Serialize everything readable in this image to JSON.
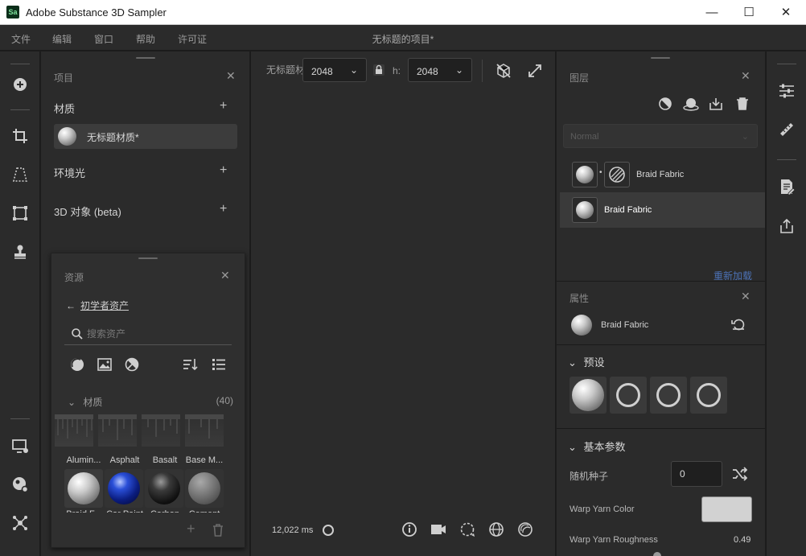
{
  "window": {
    "app_badge": "Sa",
    "title": "Adobe Substance 3D Sampler",
    "minimize": "—",
    "maximize": "☐",
    "close": "✕"
  },
  "menu": {
    "items": [
      "文件",
      "编辑",
      "窗口",
      "帮助",
      "许可证"
    ],
    "document_title": "无标题的项目*"
  },
  "project_panel": {
    "header": "项目",
    "sections": {
      "materials": "材质",
      "environment": "环境光",
      "objects_3d": "3D 对象 (beta)"
    },
    "material_item": "无标题材质*"
  },
  "assets_panel": {
    "header": "资源",
    "back_link": "初学者资产",
    "search_placeholder": "搜索资产",
    "section": "材质",
    "count": "(40)",
    "labels_row1": [
      "Alumin...",
      "Asphalt",
      "Basalt",
      "Base M..."
    ],
    "labels_row2": [
      "Braid F...",
      "Car Paint",
      "Carbon",
      "Cement"
    ]
  },
  "viewport": {
    "width_label": "无标题材",
    "width_value": "2048",
    "height_label": "h:",
    "height_value": "2048",
    "render_time": "12,022 ms"
  },
  "layers_panel": {
    "header": "图层",
    "blend_mode": "Normal",
    "layers": [
      {
        "name": "Braid Fabric",
        "selected": false
      },
      {
        "name": "Braid Fabric",
        "selected": true
      }
    ],
    "reload": "重新加载"
  },
  "properties_panel": {
    "header": "属性",
    "item_name": "Braid Fabric",
    "presets_header": "预设",
    "basic_params_header": "基本参数",
    "random_seed_label": "随机种子",
    "random_seed_value": "0",
    "warp_color_label": "Warp Yarn Color",
    "warp_color": "#d2d2d2",
    "warp_roughness_label": "Warp Yarn Roughness",
    "warp_roughness_value": "0.49"
  },
  "colors": {
    "panel_bg": "#2b2b2b",
    "link": "#4c72b6"
  }
}
